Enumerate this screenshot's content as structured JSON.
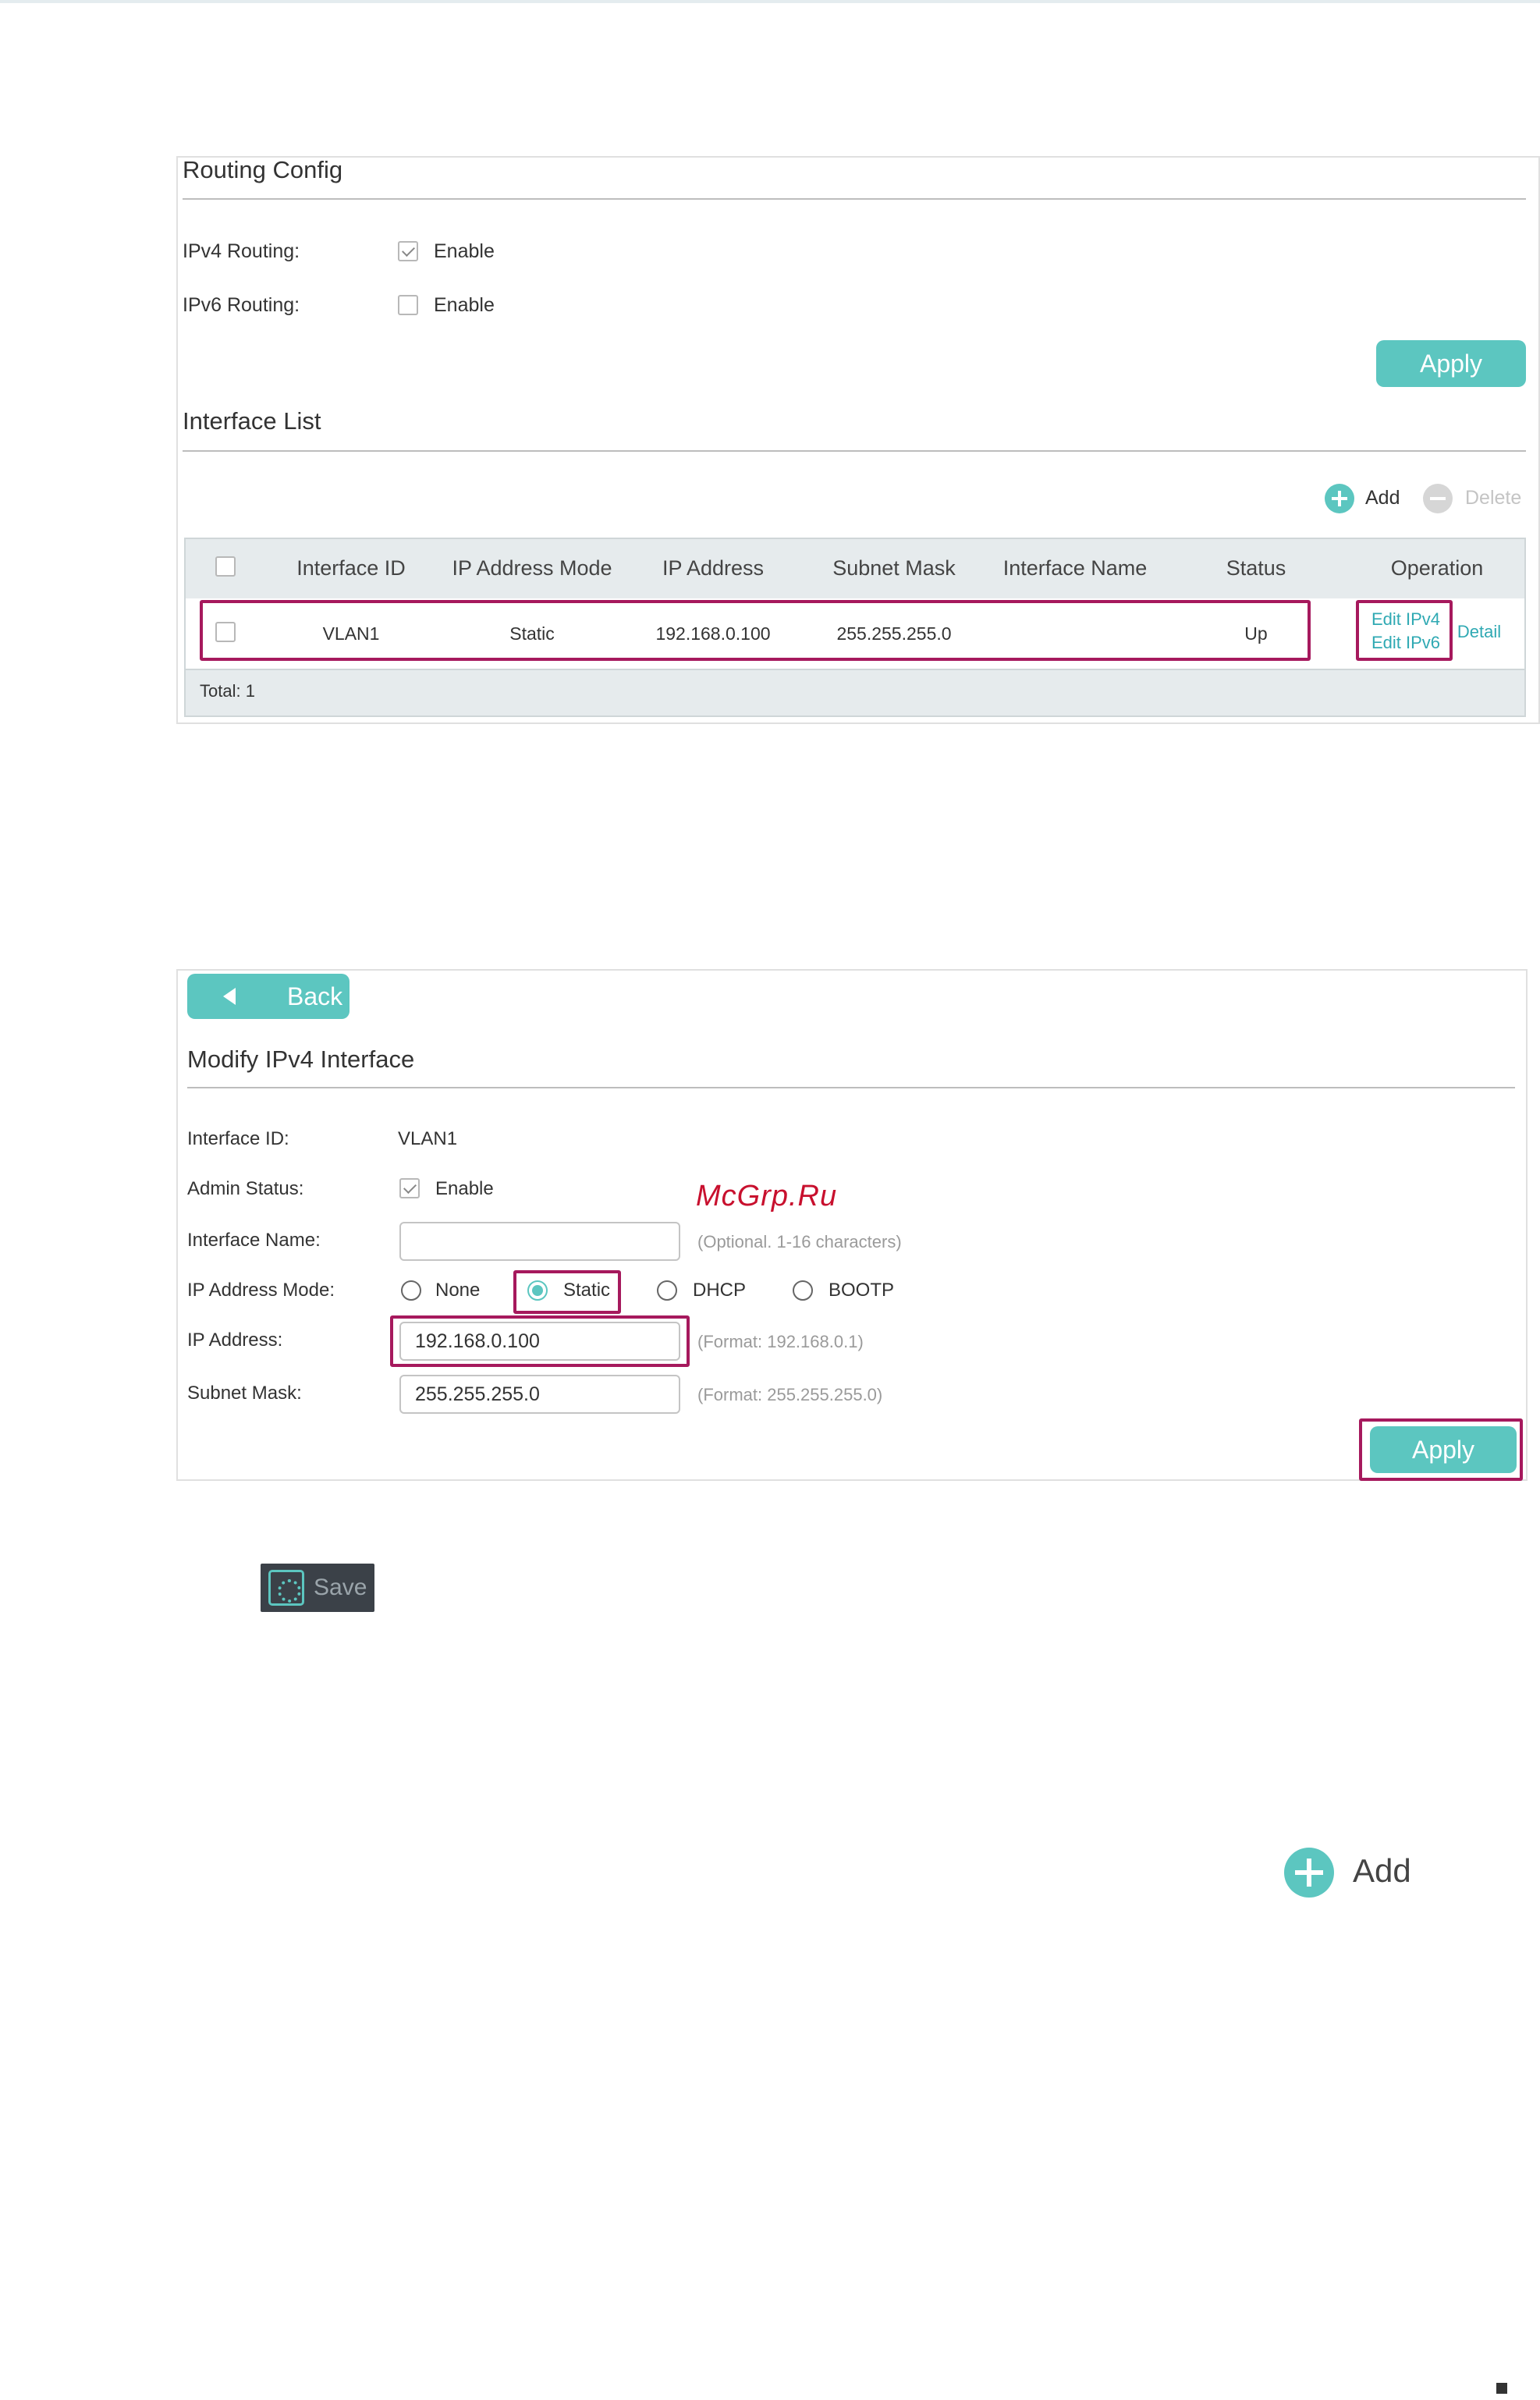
{
  "routing_config": {
    "title": "Routing Config",
    "ipv4_label": "IPv4 Routing:",
    "ipv4_enable": "Enable",
    "ipv4_checked": true,
    "ipv6_label": "IPv6 Routing:",
    "ipv6_enable": "Enable",
    "ipv6_checked": false,
    "apply_label": "Apply"
  },
  "interface_list": {
    "title": "Interface List",
    "add_label": "Add",
    "delete_label": "Delete",
    "columns": [
      "Interface ID",
      "IP Address Mode",
      "IP Address",
      "Subnet Mask",
      "Interface Name",
      "Status",
      "Operation"
    ],
    "rows": [
      {
        "interface_id": "VLAN1",
        "ip_mode": "Static",
        "ip_address": "192.168.0.100",
        "subnet_mask": "255.255.255.0",
        "interface_name": "",
        "status": "Up",
        "edit_ipv4": "Edit IPv4",
        "edit_ipv6": "Edit IPv6",
        "detail": "Detail"
      }
    ],
    "total": "Total: 1"
  },
  "modify_ipv4": {
    "back_label": "Back",
    "title": "Modify IPv4 Interface",
    "interface_id_label": "Interface ID:",
    "interface_id_value": "VLAN1",
    "admin_status_label": "Admin Status:",
    "admin_status_enable": "Enable",
    "interface_name_label": "Interface Name:",
    "interface_name_value": "",
    "interface_name_hint": "(Optional. 1-16 characters)",
    "ip_mode_label": "IP Address Mode:",
    "ip_mode_options": [
      "None",
      "Static",
      "DHCP",
      "BOOTP"
    ],
    "ip_mode_selected": "Static",
    "ip_address_label": "IP Address:",
    "ip_address_value": "192.168.0.100",
    "ip_address_hint": "(Format: 192.168.0.1)",
    "subnet_mask_label": "Subnet Mask:",
    "subnet_mask_value": "255.255.255.0",
    "subnet_mask_hint": "(Format: 255.255.255.0)",
    "apply_label": "Apply"
  },
  "watermark": "McGrp.Ru",
  "save_button": {
    "label": "Save",
    "icon": "save-gear-icon"
  },
  "add_icon_sample": {
    "label": "Add",
    "icon": "add-circle-icon"
  },
  "colors": {
    "accent": "#5cc6c0",
    "highlight": "#a6195d",
    "link": "#2fa9b3"
  }
}
